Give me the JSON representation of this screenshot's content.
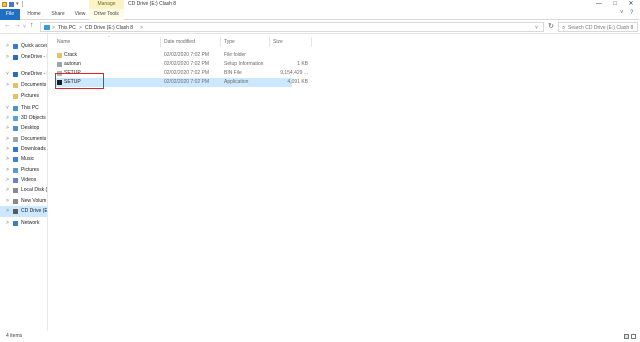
{
  "window": {
    "title": "CD Drive (E:) Clash 8",
    "context_tab": "Manage",
    "controls": {
      "minimize": "—",
      "maximize": "□",
      "close": "✕"
    }
  },
  "ribbon": {
    "tabs": [
      "File",
      "Home",
      "Share",
      "View",
      "Drive Tools"
    ],
    "expand_glyph": "˅",
    "help_glyph": "?"
  },
  "address_bar": {
    "breadcrumbs": [
      "This PC",
      "CD Drive (E:) Clash 8"
    ],
    "separator": ">",
    "dropdown_glyph": "˅",
    "refresh_glyph": "↻",
    "search_placeholder": "Search CD Drive (E:) Clash 8"
  },
  "nav_buttons": {
    "back": "←",
    "forward": "→",
    "recent": "˅",
    "up": "↑"
  },
  "nav_pane": {
    "items": [
      {
        "label": "Quick access",
        "icon": "star-icon",
        "color": "#2f7fd8",
        "caret": ">"
      },
      {
        "label": "OneDrive - B",
        "icon": "cloud-icon",
        "color": "#1f6fc5",
        "caret": ">"
      },
      {
        "label": "OneDrive - B",
        "icon": "cloud-icon",
        "color": "#1f6fc5",
        "caret": "˅"
      },
      {
        "label": "Documents",
        "icon": "folder-icon",
        "color": "#e8c255",
        "caret": ">"
      },
      {
        "label": "Pictures",
        "icon": "folder-icon",
        "color": "#e8c255",
        "caret": ""
      },
      {
        "label": "This PC",
        "icon": "computer-icon",
        "color": "#3a9ad9",
        "caret": "˅"
      },
      {
        "label": "3D Objects",
        "icon": "cube-icon",
        "color": "#4aa8e0",
        "caret": ">"
      },
      {
        "label": "Desktop",
        "icon": "desktop-icon",
        "color": "#4a8fd9",
        "caret": ">"
      },
      {
        "label": "Documents",
        "icon": "document-icon",
        "color": "#9aa5b1",
        "caret": ">"
      },
      {
        "label": "Downloads",
        "icon": "download-icon",
        "color": "#2a7bd4",
        "caret": ">"
      },
      {
        "label": "Music",
        "icon": "music-icon",
        "color": "#3a86d6",
        "caret": ">"
      },
      {
        "label": "Pictures",
        "icon": "picture-icon",
        "color": "#4aa0d8",
        "caret": ">"
      },
      {
        "label": "Videos",
        "icon": "video-icon",
        "color": "#6b7bd6",
        "caret": ">"
      },
      {
        "label": "Local Disk (",
        "icon": "drive-icon",
        "color": "#8a8a8a",
        "caret": ">"
      },
      {
        "label": "New Volum",
        "icon": "drive-icon",
        "color": "#8a8a8a",
        "caret": ">"
      },
      {
        "label": "CD Drive (E",
        "icon": "cd-drive-icon",
        "color": "#5a5a5a",
        "caret": ">",
        "selected": true
      },
      {
        "label": "Network",
        "icon": "network-icon",
        "color": "#2f7fd8",
        "caret": ">"
      }
    ]
  },
  "file_list": {
    "columns": {
      "name": "Name",
      "date": "Date modified",
      "type": "Type",
      "size": "Size"
    },
    "sort_glyph": "^",
    "rows": [
      {
        "name": "Crack",
        "date": "02/02/2020 7:02 PM",
        "type": "File folder",
        "size": "",
        "icon": "folder-icon",
        "color": "#e8c255"
      },
      {
        "name": "autorun",
        "date": "02/02/2020 7:02 PM",
        "type": "Setup Information",
        "size": "1 KB",
        "icon": "settings-file-icon",
        "color": "#9aa5b1"
      },
      {
        "name": "SETUP",
        "date": "02/02/2020 7:02 PM",
        "type": "BIN File",
        "size": "9,154,429 ...",
        "icon": "bin-file-icon",
        "color": "#b0b6bd"
      },
      {
        "name": "SETUP",
        "date": "02/02/2020 7:02 PM",
        "type": "Application",
        "size": "4,091 KB",
        "icon": "application-icon",
        "color": "#1e1e1e",
        "selected": true
      }
    ]
  },
  "status_bar": {
    "text": "4 items"
  },
  "accent_color": "#1f6fc5",
  "selection_color": "#cce8ff",
  "highlight_color": "#e02424"
}
